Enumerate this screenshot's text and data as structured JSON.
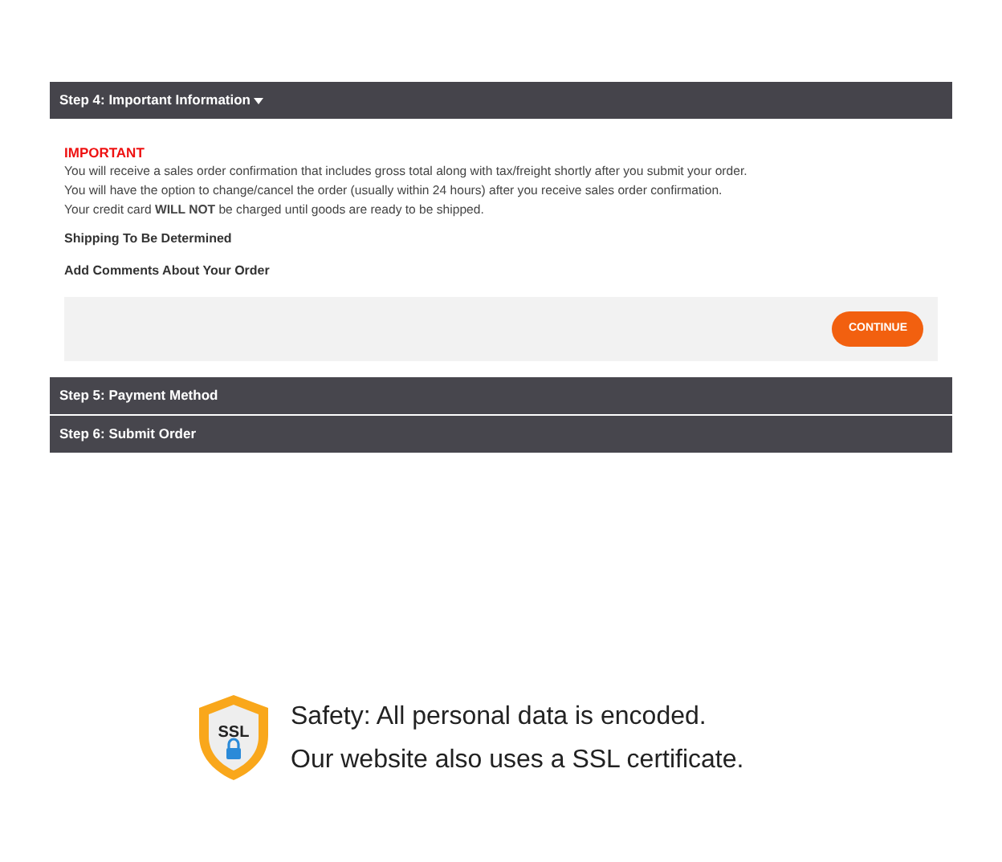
{
  "steps": [
    {
      "title": "Step 4: Important Information",
      "expanded": true
    },
    {
      "title": "Step 5: Payment Method",
      "expanded": false
    },
    {
      "title": "Step 6: Submit Order",
      "expanded": false
    }
  ],
  "important": {
    "heading": "IMPORTANT",
    "lines": [
      "You will receive a sales order confirmation that includes gross total along with tax/freight shortly after you submit your order.",
      "You will have the option to change/cancel the order (usually within 24 hours) after you receive sales order confirmation.",
      "Your credit card **WILL NOT** be charged until goods are ready to be shipped."
    ]
  },
  "shipping": "Shipping To Be Determined",
  "comments_label": "Add Comments About Your Order",
  "continue_button": "CONTINUE",
  "security": {
    "badge": "SSL",
    "lines": [
      "Safety: All personal data is encoded.",
      "Our website also uses a SSL certificate."
    ]
  }
}
